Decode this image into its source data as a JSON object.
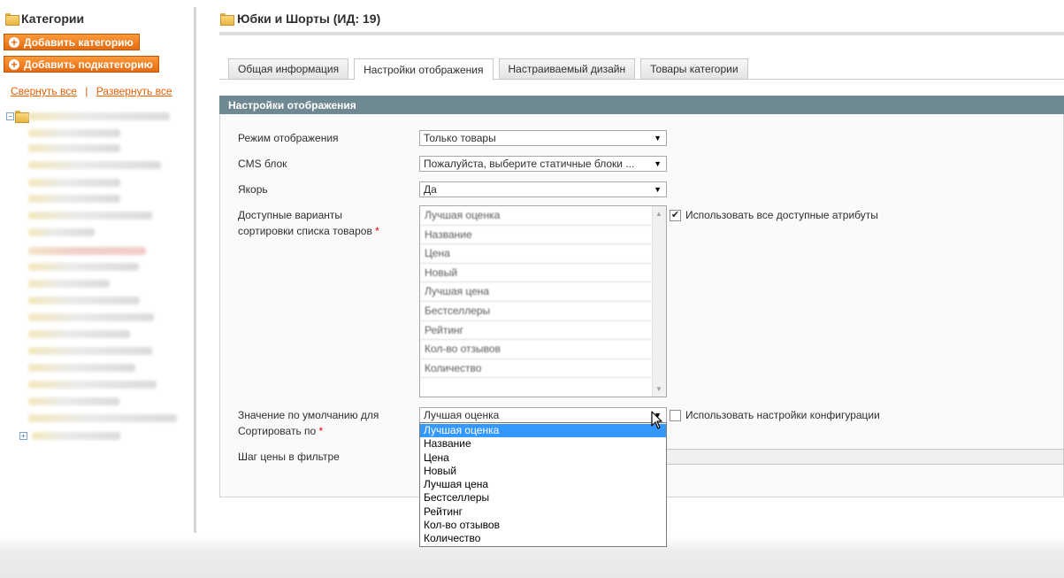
{
  "sidebar": {
    "title": "Категории",
    "add_category": "Добавить категорию",
    "add_subcategory": "Добавить подкатегорию",
    "collapse_all": "Свернуть все",
    "separator": "|",
    "expand_all": "Развернуть все"
  },
  "page": {
    "title": "Юбки и Шорты (ИД: 19)"
  },
  "tabs": [
    {
      "label": "Общая информация"
    },
    {
      "label": "Настройки отображения"
    },
    {
      "label": "Настраиваемый дизайн"
    },
    {
      "label": "Товары категории"
    }
  ],
  "section": {
    "title": "Настройки отображения",
    "display_mode_label": "Режим отображения",
    "display_mode_value": "Только товары",
    "cms_block_label": "CMS блок",
    "cms_block_value": "Пожалуйста, выберите статичные блоки ...",
    "anchor_label": "Якорь",
    "anchor_value": "Да",
    "sort_options_label_1": "Доступные варианты",
    "sort_options_label_2": "сортировки списка товаров",
    "required_mark": "*",
    "use_all_attributes": "Использовать все доступные атрибуты",
    "default_sort_label_1": "Значение по умолчанию для",
    "default_sort_label_2": "Сортировать по",
    "default_sort_value": "Лучшая оценка",
    "use_config_settings": "Использовать настройки конфигурации",
    "price_step_label": "Шаг цены в фильтре"
  },
  "sort_options": [
    "Лучшая оценка",
    "Название",
    "Цена",
    "Новый",
    "Лучшая цена",
    "Бестселлеры",
    "Рейтинг",
    "Кол-во отзывов",
    "Количество"
  ],
  "dropdown_options": [
    "Лучшая оценка",
    "Название",
    "Цена",
    "Новый",
    "Лучшая цена",
    "Бестселлеры",
    "Рейтинг",
    "Кол-во отзывов",
    "Количество"
  ],
  "checkboxes": {
    "use_all_attributes_checked": true,
    "use_config_checked": false
  },
  "icons": {
    "folder": "folder-icon",
    "plus": "plus-circle-icon",
    "dropdown": "triangle-down-icon",
    "check": "✔",
    "cursor": "mouse-pointer-icon"
  },
  "colors": {
    "accent_orange": "#eb5e00",
    "section_header": "#6f8992",
    "selection_blue": "#3399ff"
  }
}
